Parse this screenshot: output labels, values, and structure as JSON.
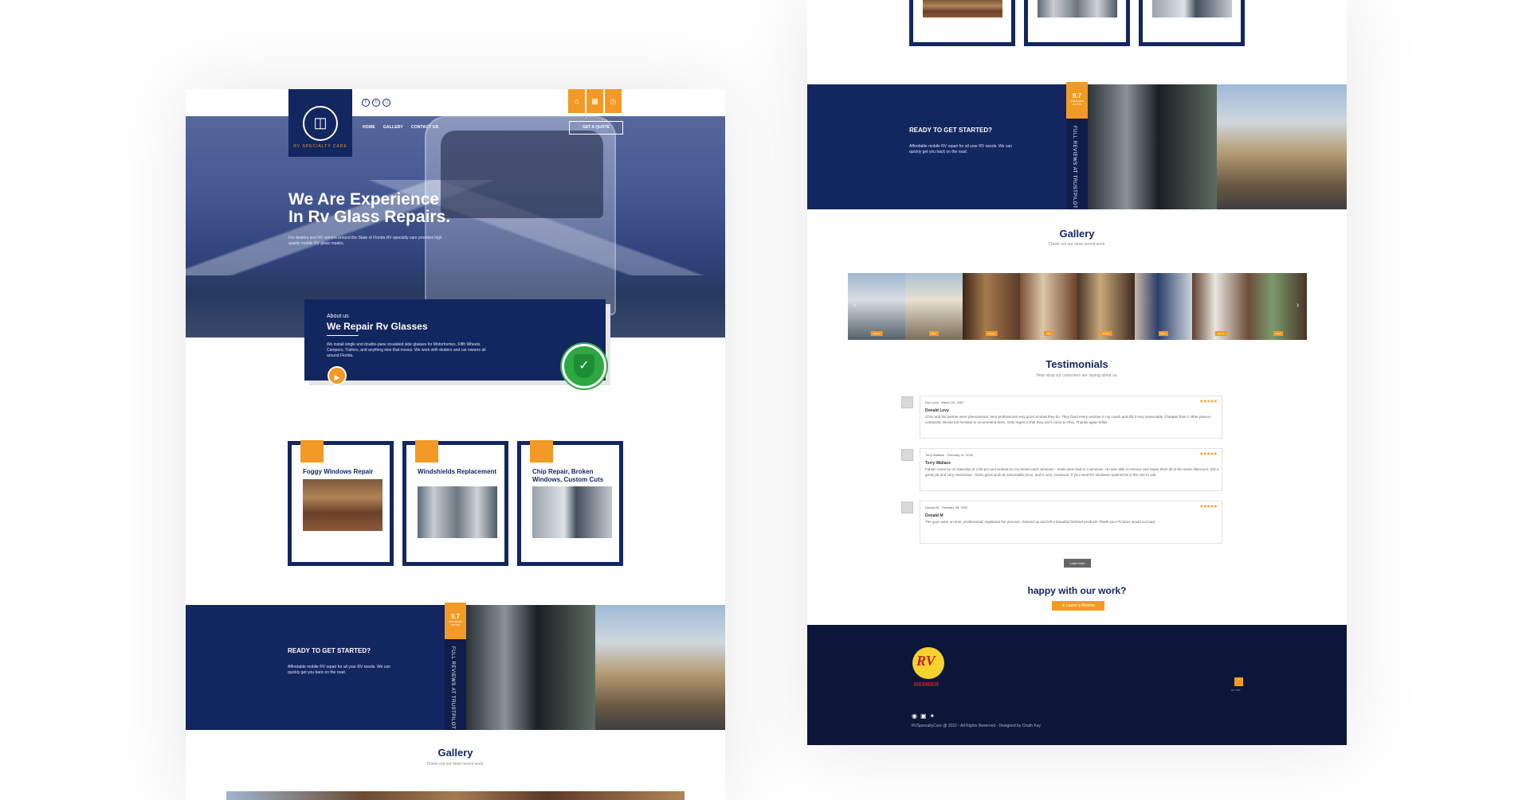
{
  "left": {
    "nav": {
      "home": "HOME",
      "gallery": "GALLERY",
      "contact": "CONTACT US",
      "quote": "GET A QUOTE"
    },
    "logo_text": "RV SPECIALTY CARE",
    "social_icons": [
      "facebook-icon",
      "twitter-icon",
      "instagram-icon"
    ],
    "top_icons": [
      "home-icon",
      "bus-icon",
      "clock-icon"
    ],
    "hero": {
      "title_line1": "We Are Experience",
      "title_line2": "In Rv Glass Repairs.",
      "subtitle": "For dealers and RV owners around the State of Florida RV specialty care provides high quality mobile RV glass repairs."
    },
    "about": {
      "eyebrow": "About us",
      "title": "We Repair Rv Glasses",
      "text": "We install single and double-pane insulated side glasses for Motorhomes, Fifth Wheels, Campers, Trailers, and anything else that moves. We work with dealers and car owners all around Florida."
    },
    "services": [
      {
        "title": "Foggy Windows Repair"
      },
      {
        "title": "Windshields Replacement"
      },
      {
        "title": "Chip Repair, Broken Windows, Custom Cuts"
      }
    ],
    "ready": {
      "title": "READY TO GET STARTED?",
      "text": "Affordable mobile RV repair for all your RV needs. We can quickly get you back on the road.",
      "score": "9.7",
      "score_caption": "CUSTOMER RATING",
      "trust_label": "FULL REVIEWS AT TRUSTPILOT"
    },
    "gallery": {
      "title": "Gallery",
      "subtitle": "Check out our most recent work."
    }
  },
  "right": {
    "ready": {
      "title": "READY TO GET STARTED?",
      "text": "Affordable mobile RV repair for all your RV needs. We can quickly get you back on the road.",
      "score": "9.7",
      "score_caption": "CUSTOMER RATING",
      "trust_label": "FULL REVIEWS AT TRUSTPILOT"
    },
    "gallery": {
      "title": "Gallery",
      "subtitle": "Check out our most recent work."
    },
    "testimonials": {
      "title": "Testimonials",
      "subtitle": "Hear what our customers are saying about us.",
      "reviews": [
        {
          "head": "Don Levy - March 24, 2022",
          "name": "Donald Levy",
          "text": "Chris and his partner were phenomenal. Very professional very good at what they do. They fixed every window in my coach and did it very reasonably. Cheaper than 2 other places I contacted. Would not hesitate to recommend them. Only regret is that they don't come to Ohio. Thanks again fellas."
        },
        {
          "head": "Terry Wallace - February 11, 2022",
          "name": "Terry Wallace",
          "text": "Fabian came by on Saturday at 1:08 pm and worked on my Motorcoach windows - Seals were bad in 3 windows. He was able to remove and repair them all in the same afternoon. Did a great job and very meticulous - Does great work at reasonable price, and is very courteous. If you need RV windows repaired he is the one to call."
        },
        {
          "head": "Donald M - February 08, 2022",
          "name": "Donald M",
          "text": "The guys were on time, professional, explained the process, cleaned up and left a beautiful finished product!! Thank you! Pictures would not load."
        }
      ],
      "stars": "★★★★★",
      "load_more": "Load more"
    },
    "happy": "happy with our work?",
    "leave_review": "★ Leave a Review",
    "footer": {
      "copyright": "RVSpecialtyCare @ 2022 - All Rights Reserved - Designed by Chath Kay",
      "rvia_letters": "RV",
      "rvia_member": "MEMBER",
      "top_label": "GO TOP"
    }
  }
}
